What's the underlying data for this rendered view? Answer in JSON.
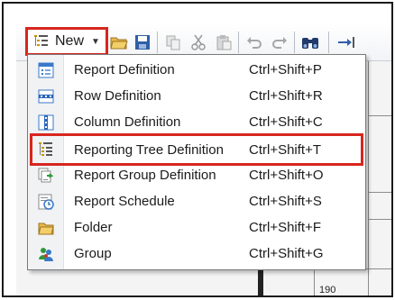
{
  "toolbar": {
    "new_label": "New",
    "buttons": [
      "open-icon",
      "save-icon",
      "copy-icon",
      "cut-icon",
      "paste-icon",
      "undo-icon",
      "redo-icon",
      "find-icon",
      "more-icon"
    ]
  },
  "background": {
    "cell_value": "190"
  },
  "menu": {
    "items": [
      {
        "label": "Report Definition",
        "shortcut": "Ctrl+Shift+P",
        "icon": "report-definition-icon"
      },
      {
        "label": "Row Definition",
        "shortcut": "Ctrl+Shift+R",
        "icon": "row-definition-icon"
      },
      {
        "label": "Column Definition",
        "shortcut": "Ctrl+Shift+C",
        "icon": "column-definition-icon"
      },
      {
        "label": "Reporting Tree Definition",
        "shortcut": "Ctrl+Shift+T",
        "icon": "reporting-tree-icon",
        "highlighted": true
      },
      {
        "label": "Report Group Definition",
        "shortcut": "Ctrl+Shift+O",
        "icon": "report-group-icon"
      },
      {
        "label": "Report Schedule",
        "shortcut": "Ctrl+Shift+S",
        "icon": "report-schedule-icon"
      },
      {
        "label": "Folder",
        "shortcut": "Ctrl+Shift+F",
        "icon": "folder-icon"
      },
      {
        "label": "Group",
        "shortcut": "Ctrl+Shift+G",
        "icon": "group-icon"
      }
    ]
  },
  "colors": {
    "highlight_border": "#d7261e",
    "menu_background": "#ffffff",
    "gutter": "#f1f2f4"
  }
}
